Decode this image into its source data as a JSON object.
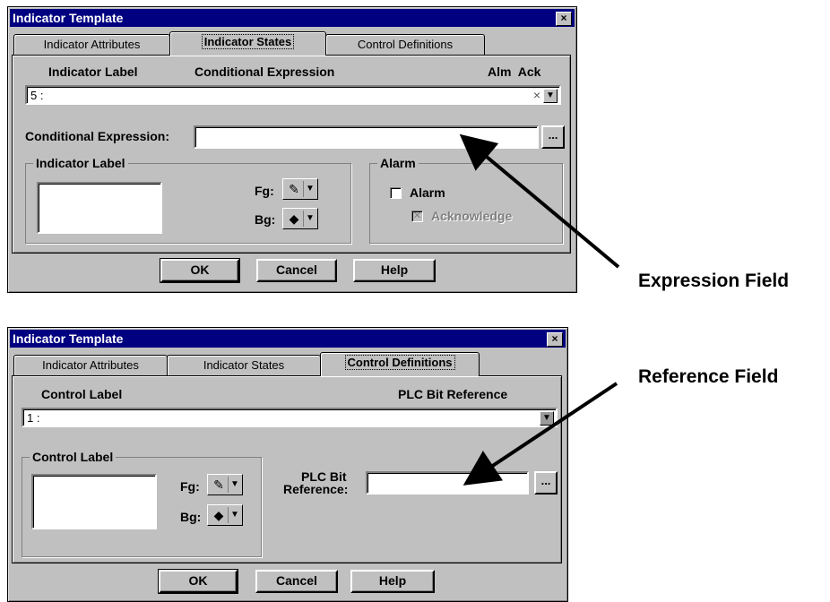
{
  "dialog1": {
    "title": "Indicator Template",
    "close": "×",
    "tabs": [
      "Indicator Attributes",
      "Indicator States",
      "Control Definitions"
    ],
    "columns": {
      "label": "Indicator Label",
      "expression": "Conditional Expression",
      "alm_ack": "Alm  Ack"
    },
    "combo_value": "5 :",
    "combo_mark": "×",
    "cond_expr_label": "Conditional Expression:",
    "cond_expr_value": "",
    "ellipsis": "...",
    "indicator_label_group": "Indicator Label",
    "fg_label": "Fg:",
    "bg_label": "Bg:",
    "alarm_group": "Alarm",
    "alarm_check_label": "Alarm",
    "ack_check_label": "Acknowledge",
    "buttons": {
      "ok": "OK",
      "cancel": "Cancel",
      "help": "Help"
    }
  },
  "dialog2": {
    "title": "Indicator Template",
    "close": "×",
    "tabs": [
      "Indicator Attributes",
      "Indicator States",
      "Control Definitions"
    ],
    "columns": {
      "label": "Control Label",
      "reference": "PLC Bit Reference"
    },
    "combo_value": "1 :",
    "control_label_group": "Control Label",
    "fg_label": "Fg:",
    "bg_label": "Bg:",
    "plc_label_line1": "PLC Bit",
    "plc_label_line2": "Reference:",
    "plc_value": "",
    "ellipsis": "...",
    "buttons": {
      "ok": "OK",
      "cancel": "Cancel",
      "help": "Help"
    }
  },
  "annotations": {
    "expression_field": "Expression Field",
    "reference_field": "Reference Field"
  }
}
